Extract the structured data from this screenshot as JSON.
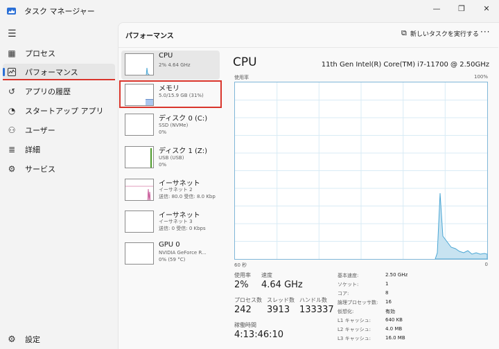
{
  "window": {
    "title": "タスク マネージャー",
    "minimize": "—",
    "maximize": "❐",
    "close": "✕"
  },
  "sidebar": {
    "items": [
      {
        "label": "プロセス",
        "icon": "processes-icon"
      },
      {
        "label": "パフォーマンス",
        "icon": "performance-icon"
      },
      {
        "label": "アプリの履歴",
        "icon": "history-icon"
      },
      {
        "label": "スタートアップ アプリ",
        "icon": "startup-icon"
      },
      {
        "label": "ユーザー",
        "icon": "users-icon"
      },
      {
        "label": "詳細",
        "icon": "details-icon"
      },
      {
        "label": "サービス",
        "icon": "services-icon"
      }
    ],
    "settings": "設定"
  },
  "header": {
    "title": "パフォーマンス",
    "run_task": "新しいタスクを実行する"
  },
  "tiles": [
    {
      "name": "CPU",
      "line1": "2%  4.64 GHz",
      "line2": ""
    },
    {
      "name": "メモリ",
      "line1": "5.0/15.9 GB (31%)",
      "line2": ""
    },
    {
      "name": "ディスク 0 (C:)",
      "line1": "SSD (NVMe)",
      "line2": "0%"
    },
    {
      "name": "ディスク 1 (Z:)",
      "line1": "USB (USB)",
      "line2": "0%"
    },
    {
      "name": "イーサネット",
      "line1": "イーサネット 2",
      "line2": "送信: 80.0  受信: 8.0 Kbp"
    },
    {
      "name": "イーサネット",
      "line1": "イーサネット 3",
      "line2": "送信: 0  受信: 0 Kbps"
    },
    {
      "name": "GPU 0",
      "line1": "NVIDIA GeForce R...",
      "line2": "0%  (59 °C)"
    }
  ],
  "detail": {
    "title": "CPU",
    "model": "11th Gen Intel(R) Core(TM) i7-11700 @ 2.50GHz",
    "usage_label": "使用率",
    "max_label": "100%",
    "time_label": "60 秒",
    "min_label": "0",
    "stats": {
      "usage_label": "使用率",
      "usage": "2%",
      "speed_label": "速度",
      "speed": "4.64 GHz",
      "processes_label": "プロセス数",
      "processes": "242",
      "threads_label": "スレッド数",
      "threads": "3913",
      "handles_label": "ハンドル数",
      "handles": "133337",
      "uptime_label": "稼働時間",
      "uptime": "4:13:46:10"
    },
    "specs": [
      {
        "k": "基本速度:",
        "v": "2.50 GHz"
      },
      {
        "k": "ソケット:",
        "v": "1"
      },
      {
        "k": "コア:",
        "v": "8"
      },
      {
        "k": "論理プロセッサ数:",
        "v": "16"
      },
      {
        "k": "仮想化:",
        "v": "有効"
      },
      {
        "k": "L1 キャッシュ:",
        "v": "640 KB"
      },
      {
        "k": "L2 キャッシュ:",
        "v": "4.0 MB"
      },
      {
        "k": "L3 キャッシュ:",
        "v": "16.0 MB"
      }
    ]
  },
  "colors": {
    "accent": "#2a6fd6",
    "highlight": "#d9342b",
    "cpu_line": "#4aa6d4",
    "cpu_fill": "#c7e3f1"
  }
}
